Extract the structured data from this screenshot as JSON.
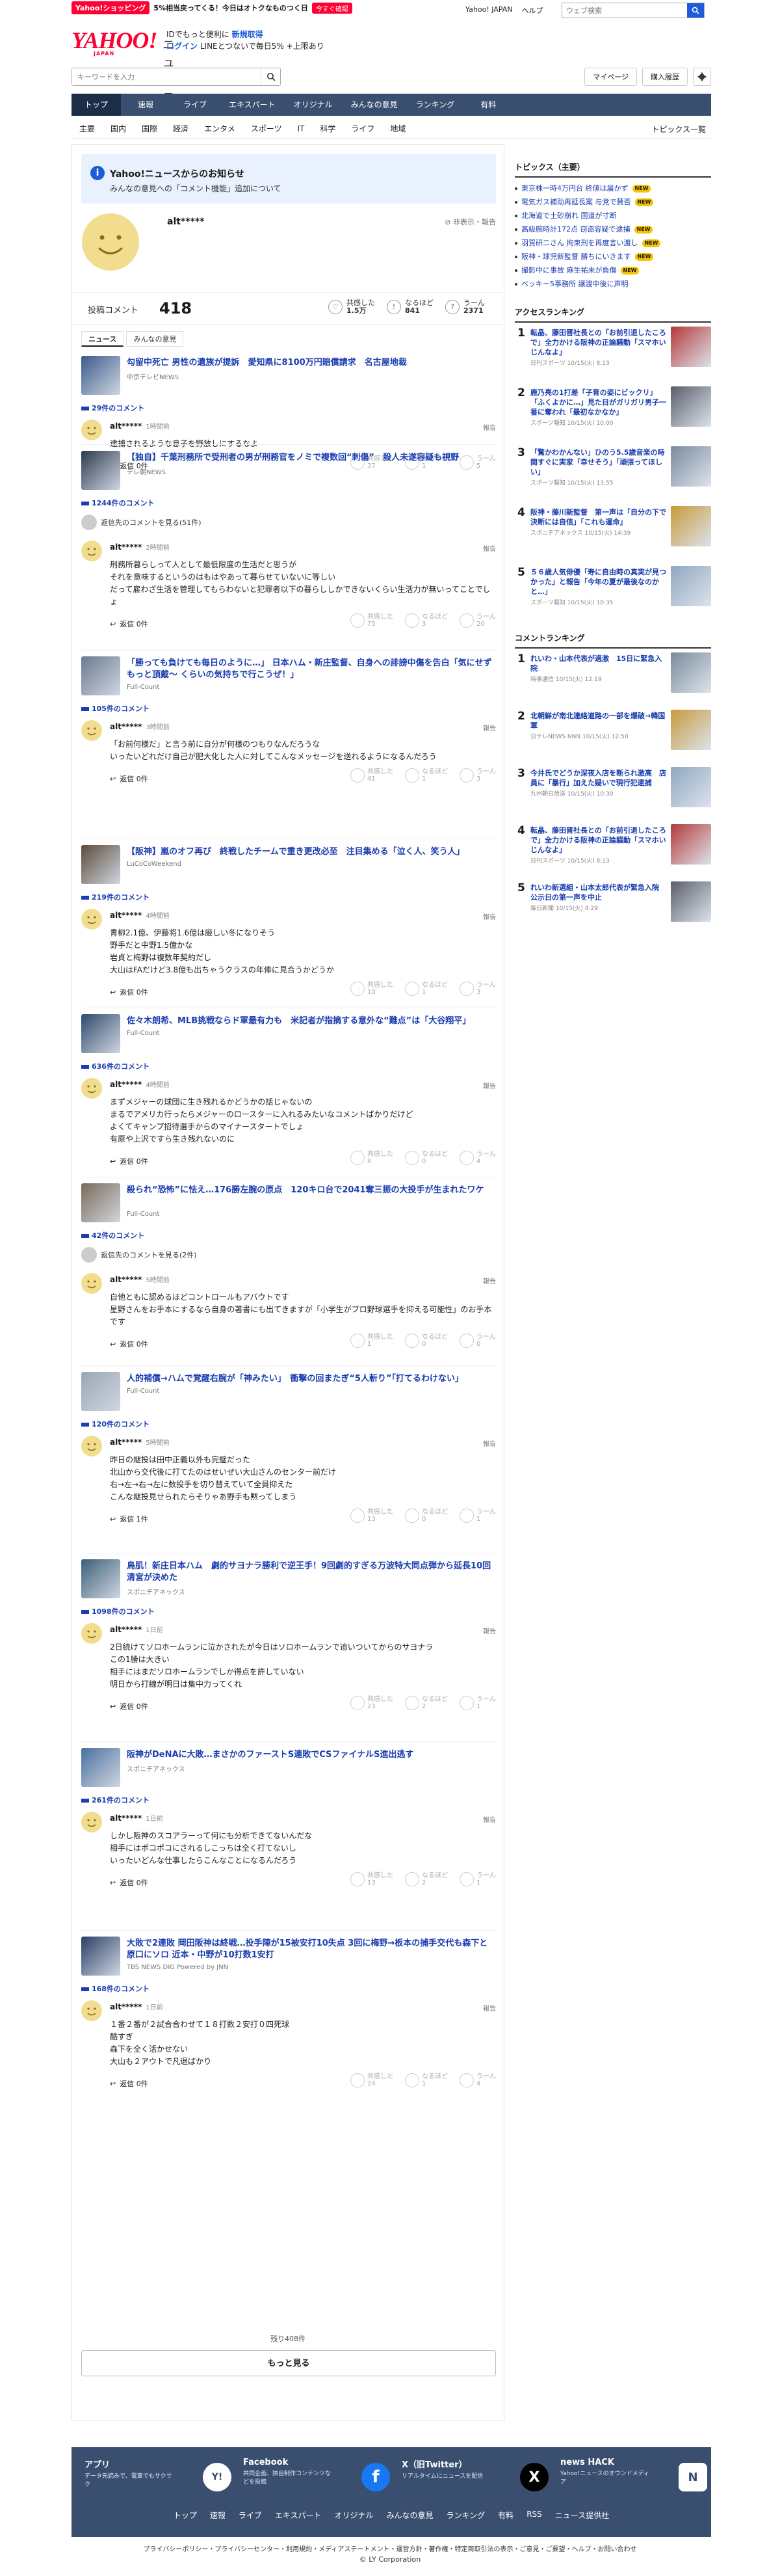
{
  "header": {
    "shopping_badge": "Yahoo!ショッピング",
    "shopping_promo": "5%相当戻ってくる！今日はオトクなものつく日",
    "shopping_more": "今すぐ確認",
    "top_links": [
      "Yahoo! JAPAN",
      "ヘルプ"
    ],
    "top_search_placeholder": "ウェブ検索",
    "logo_text": "YAHOO!",
    "logo_sub": "JAPAN",
    "logo_news": "ニュース",
    "promo_line1_a": "IDでもっと便利に",
    "promo_line1_b": "新規取得",
    "promo_line2_a": "ログイン",
    "promo_line2_b": "LINEとつないで毎日5% +上限あり"
  },
  "searchbar": {
    "placeholder": "キーワードを入力",
    "mypage": "マイページ",
    "purchase": "購入履歴"
  },
  "nav": [
    "トップ",
    "速報",
    "ライブ",
    "エキスパート",
    "オリジナル",
    "みんなの意見",
    "ランキング",
    "有料"
  ],
  "subnav": [
    "主要",
    "国内",
    "国際",
    "経済",
    "エンタメ",
    "スポーツ",
    "IT",
    "科学",
    "ライフ",
    "地域"
  ],
  "subnav_right": "トピックス一覧",
  "notice": {
    "title": "Yahoo!ニュースからのお知らせ",
    "body": "みんなの意見への「コメント機能」追加について"
  },
  "profile": {
    "username": "alt*****",
    "hide_label": "非表示・報告"
  },
  "stats": {
    "label": "投稿コメント",
    "count": "418",
    "r1_label": "共感した",
    "r1_value": "1.5万",
    "r2_label": "なるほど",
    "r2_value": "841",
    "r3_label": "うーん",
    "r3_value": "2371"
  },
  "tabs": [
    "ニュース",
    "みんなの意見"
  ],
  "articles": [
    {
      "title": "勾留中死亡 男性の遺族が提訴　愛知県に8100万円賠償請求　名古屋地裁",
      "source": "中京テレビNEWS",
      "comments": "29件のコメント",
      "replies": "",
      "user": "alt*****",
      "time": "1時間前",
      "text": "逮捕されるような息子を野放しにするなよ",
      "reply": "返信 0件",
      "r1": "共感した",
      "v1": "37",
      "r2": "なるほど",
      "v2": "1",
      "r3": "うーん",
      "v3": "5"
    },
    {
      "title": "【独自】千葉刑務所で受刑者の男が刑務官をノミで複数回“刺傷”　殺人未遂容疑も視野",
      "source": "テレ朝NEWS",
      "comments": "1244件のコメント",
      "replies": "返信先のコメントを見る(51件)",
      "user": "alt*****",
      "time": "2時間前",
      "text": "刑務所暮らしって人として最低限度の生活だと思うが\nそれを意味するというのはもはやあって暮らせていないに等しい\nだって雇わざ生活を管理してもらわないと犯罪者以下の暮らししかできないくらい生活力が無いってことでしょ",
      "reply": "返信 0件",
      "r1": "共感した",
      "v1": "75",
      "r2": "なるほど",
      "v2": "3",
      "r3": "うーん",
      "v3": "20"
    },
    {
      "title": "「勝っても負けても毎日のように…」 日本ハム・新庄監督、自身への誹謗中傷を告白「気にせず もっと頂戴〜 くらいの気持ちで行こうぜ！」",
      "source": "Full-Count",
      "comments": "105件のコメント",
      "replies": "",
      "user": "alt*****",
      "time": "3時間前",
      "text": "「お前何様だ」と言う前に自分が何様のつもりなんだろうな\nいったいどれだけ自己が肥大化した人に対してこんなメッセージを送れるようになるんだろう",
      "reply": "返信 0件",
      "r1": "共感した",
      "v1": "41",
      "r2": "なるほど",
      "v2": "1",
      "r3": "うーん",
      "v3": "3"
    },
    {
      "title": "【阪神】嵐のオフ再び　終戦したチームで重き更改必至　注目集める「泣く人、笑う人」",
      "source": "LuCoCoWeekend",
      "comments": "219件のコメント",
      "replies": "",
      "user": "alt*****",
      "time": "4時間前",
      "text": "青柳2.1億、伊藤将1.6億は厳しい冬になりそう\n野手だと中野1.5億かな\n岩貞と梅野は複数年契約だし\n大山はFAだけど3.8億も出ちゃうクラスの年俸に見合うかどうか",
      "reply": "返信 0件",
      "r1": "共感した",
      "v1": "10",
      "r2": "なるほど",
      "v2": "1",
      "r3": "うーん",
      "v3": "3"
    },
    {
      "title": "佐々木朗希、MLB挑戦ならド軍最有力も　米記者が指摘する意外な“難点”は「大谷翔平」",
      "source": "Full-Count",
      "comments": "636件のコメント",
      "replies": "",
      "user": "alt*****",
      "time": "4時間前",
      "text": "まずメジャーの球団に生き残れるかどうかの話じゃないの\nまるでアメリカ行ったらメジャーのロースターに入れるみたいなコメントばかりだけど\nよくてキャンプ招待選手からのマイナースタートでしょ\n有原や上沢ですら生き残れないのに",
      "reply": "返信 0件",
      "r1": "共感した",
      "v1": "8",
      "r2": "なるほど",
      "v2": "0",
      "r3": "うーん",
      "v3": "4"
    },
    {
      "title": "殺られ“恐怖”に怯え…176勝左腕の原点　120キロ台で2041奪三振の大投手が生まれたワケ",
      "source": "Full-Count",
      "comments": "42件のコメント",
      "replies": "返信先のコメントを見る(2件)",
      "user": "alt*****",
      "time": "5時間前",
      "text": "自他ともに認めるほどコントロールもアバウトです\n星野さんをお手本にするなら自身の著書にも出てきますが「小学生がプロ野球選手を抑える可能性」のお手本です",
      "reply": "返信 0件",
      "r1": "共感した",
      "v1": "1",
      "r2": "なるほど",
      "v2": "0",
      "r3": "うーん",
      "v3": "0"
    },
    {
      "title": "人的補償→ハムで覚醒右腕が「神みたい」　衝撃の回またぎ“5人斬り”「打てるわけない」",
      "source": "Full-Count",
      "comments": "120件のコメント",
      "replies": "",
      "user": "alt*****",
      "time": "5時間前",
      "text": "昨日の継投は田中正義以外も完璧だった\n北山から交代後に打てたのはせいぜい大山さんのセンター前だけ\n右→左→右→左に数投手を切り替えていて全員抑えた\nこんな継投見せられたらそりゃあ野手も黙ってしまう",
      "reply": "返信 1件",
      "r1": "共感した",
      "v1": "13",
      "r2": "なるほど",
      "v2": "0",
      "r3": "うーん",
      "v3": "1"
    },
    {
      "title": "鳥肌！新庄日本ハム　劇的サヨナラ勝利で逆王手！9回劇的すぎる万波特大同点弾から延長10回清宮が決めた",
      "source": "スポニチアネックス",
      "comments": "1098件のコメント",
      "replies": "",
      "user": "alt*****",
      "time": "1日前",
      "text": "2日続けてソロホームランに泣かされたが今日はソロホームランで追いついてからのサヨナラ\nこの1勝は大きい\n相手にはまだソロホームランでしか得点を許していない\n明日から打線が明日は集中力ってくれ",
      "reply": "返信 0件",
      "r1": "共感した",
      "v1": "23",
      "r2": "なるほど",
      "v2": "2",
      "r3": "うーん",
      "v3": "1"
    },
    {
      "title": "阪神がDeNAに大敗…まさかのファーストS連敗でCSファイナルS進出逃す",
      "source": "スポニチアネックス",
      "comments": "261件のコメント",
      "replies": "",
      "user": "alt*****",
      "time": "1日前",
      "text": "しかし阪神のスコアラーって何にも分析できてないんだな\n相手にはポコポコにされるしこっちは全く打てないし\nいったいどんな仕事したらこんなことになるんだろう",
      "reply": "返信 0件",
      "r1": "共感した",
      "v1": "13",
      "r2": "なるほど",
      "v2": "2",
      "r3": "うーん",
      "v3": "1"
    },
    {
      "title": "大敗で2連敗 岡田阪神は終戦…投手陣が15被安打10失点 3回に梅野→板本の捕手交代も森下と原口にソロ 近本・中野が10打数1安打",
      "source": "TBS NEWS DIG Powered by JNN",
      "comments": "168件のコメント",
      "replies": "",
      "user": "alt*****",
      "time": "1日前",
      "text": "１番２番が２試合合わせて１８打数２安打０四死球\n酷すぎ\n森下を全く活かせない\n大山も２アウトで凡退ばかり",
      "reply": "返信 0件",
      "r1": "共感した",
      "v1": "24",
      "r2": "なるほど",
      "v2": "1",
      "r3": "うーん",
      "v3": "4"
    }
  ],
  "remaining": "残り408件",
  "more_button": "もっと見る",
  "sidebar": {
    "topics_title": "トピックス（主要）",
    "topics": [
      {
        "text": "東京株一時4万円台 終値は届かず",
        "new": "NEW"
      },
      {
        "text": "電気ガス補助再延長案 与党で賛否",
        "new": "NEW"
      },
      {
        "text": "北海道で土砂崩れ 国道が寸断",
        "new": ""
      },
      {
        "text": "高級腕時計172点 窃盗容疑で逮捕",
        "new": "NEW"
      },
      {
        "text": "羽賀研二さん 拘束刑を再度言い渡し",
        "new": "NEW"
      },
      {
        "text": "阪神・球児新監督 勝ちにいきます",
        "new": "NEW"
      },
      {
        "text": "撮影中に事故 麻生祐未が負傷",
        "new": "NEW"
      },
      {
        "text": "ベッキー5事務所 譲渡中後に声明",
        "new": ""
      }
    ],
    "new_label": "NEW",
    "access_title": "アクセスランキング",
    "access": [
      {
        "n": "1",
        "t": "転晶、藤田晋社長との「お前引退したころで」全力かける阪神の正論騒動「スマホいじんなよ」",
        "s": "日刊スポーツ 10/15(火) 8:13"
      },
      {
        "n": "2",
        "t": "鹿乃亮の1打差「子育の姿にビックリ」「ふくよかに…」見た目がガリガリ男子一番に奪われ「最初なかなか」",
        "s": "スポーツ報知 10/15(火) 10:00"
      },
      {
        "n": "3",
        "t": "「驚かわかんない」ひのう5.5歳音楽の時間すぐに実家「幸せそう」「頑張ってほしい」",
        "s": "スポーツ報知 10/15(火) 13:55"
      },
      {
        "n": "4",
        "t": "阪神・藤川新監督　第一声は「自分の下で決断には自信」「これも運命」",
        "s": "スポニチアネックス 10/15(火) 14:39"
      },
      {
        "n": "5",
        "t": "５６歳人気俳優「寿に自由時の真実が見つかった」と報告「今年の夏が最後なのかと…」",
        "s": "スポーツ報知 10/15(火) 10:35"
      }
    ],
    "comment_title": "コメントランキング",
    "comment": [
      {
        "n": "1",
        "t": "れいわ・山本代表が過激　15日に緊急入院",
        "s": "時事通信 10/15(火) 12:19"
      },
      {
        "n": "2",
        "t": "北朝鮮が南北連絡道路の一部を爆破→韓国軍",
        "s": "日テレNEWS NNN 10/15(火) 12:50"
      },
      {
        "n": "3",
        "t": "今井氏でどうか深夜入店を断られ激高　店員に「暴行」加えた疑いで現行犯逮捕",
        "s": "九州朝日放送 10/15(火) 10:30"
      },
      {
        "n": "4",
        "t": "転晶、藤田晋社長との「お前引退したころで」全力かける阪神の正論騒動「スマホいじんなよ」",
        "s": "日刊スポーツ 10/15(火) 8:13"
      },
      {
        "n": "5",
        "t": "れいわ新選組・山本太郎代表が緊急入院　公示日の第一声を中止",
        "s": "毎日新聞 10/15(火) 4:29"
      }
    ]
  },
  "footer": {
    "apps": [
      {
        "h": "アプリ",
        "d": "データ先読みで、電車でもサクサク",
        "icon": "Y!"
      },
      {
        "h": "Facebook",
        "d": "共同企画、独自制作コンテンツなどを投稿",
        "icon": "f"
      },
      {
        "h": "X（旧Twitter）",
        "d": "リアルタイムにニュースを配信",
        "icon": "X"
      },
      {
        "h": "news HACK",
        "d": "Yahoo!ニュースのオウンドメディア",
        "icon": "N"
      }
    ],
    "nav": [
      "トップ",
      "速報",
      "ライブ",
      "エキスパート",
      "オリジナル",
      "みんなの意見",
      "ランキング",
      "有料",
      "RSS",
      "ニュース提供社"
    ],
    "links": "プライバシーポリシー・プライバシーセンター・利用規約・メディアステートメント・運営方針・著作権・特定商取引法の表示・ご意見・ご要望・ヘルプ・お問い合わせ",
    "copyright": "© LY Corporation"
  }
}
